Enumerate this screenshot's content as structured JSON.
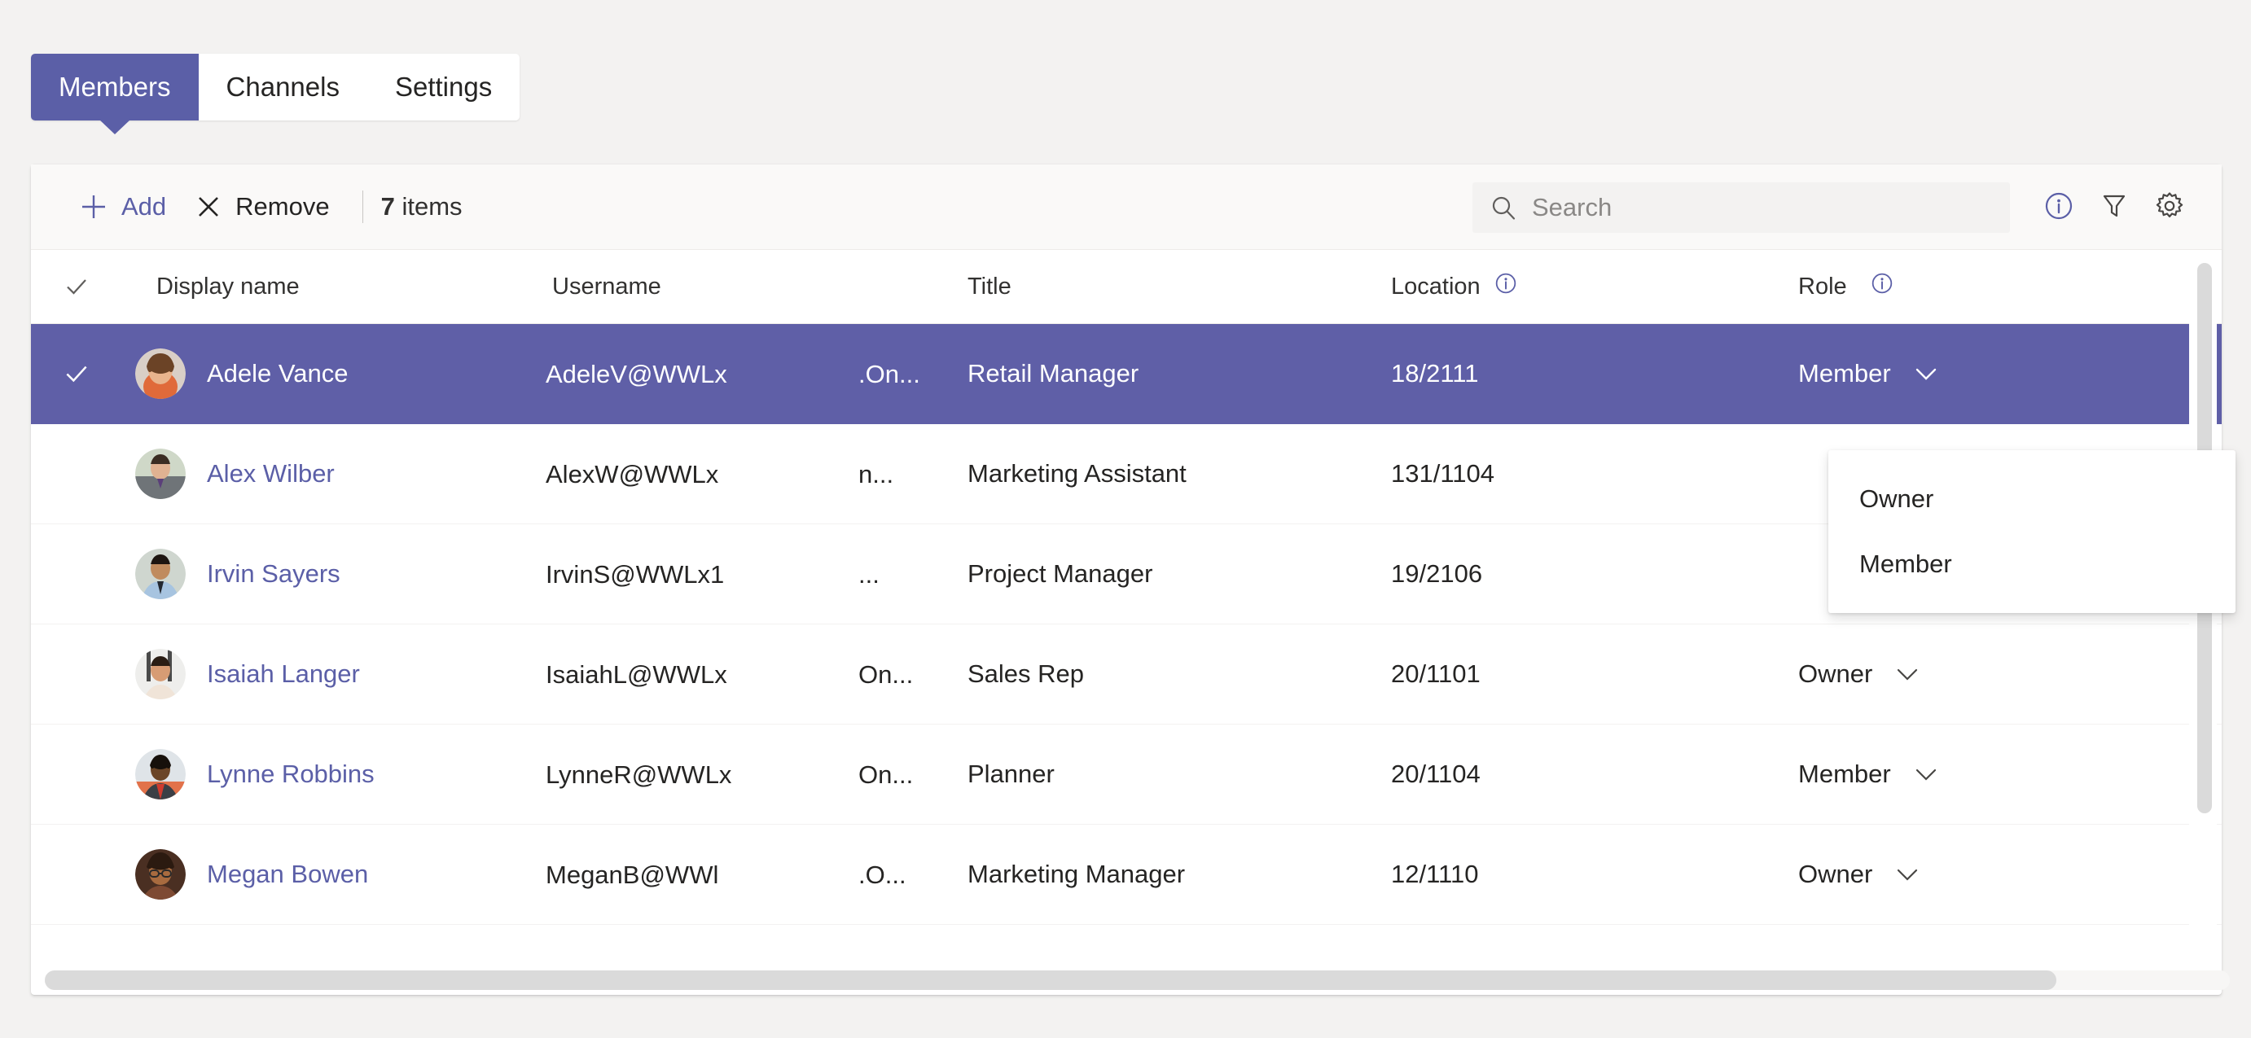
{
  "tabs": [
    {
      "label": "Members",
      "active": true
    },
    {
      "label": "Channels",
      "active": false
    },
    {
      "label": "Settings",
      "active": false
    }
  ],
  "toolbar": {
    "add_label": "Add",
    "remove_label": "Remove",
    "items_count": "7",
    "items_label": "items"
  },
  "search": {
    "placeholder": "Search",
    "value": ""
  },
  "columns": {
    "display_name": "Display name",
    "username": "Username",
    "title": "Title",
    "location": "Location",
    "role": "Role"
  },
  "rows": [
    {
      "display_name": "Adele Vance",
      "username_main": "AdeleV@WWLx",
      "username_tail": ".On...",
      "title": "Retail Manager",
      "location": "18/2111",
      "role": "Member",
      "selected": true
    },
    {
      "display_name": "Alex Wilber",
      "username_main": "AlexW@WWLx",
      "username_tail": "n...",
      "title": "Marketing Assistant",
      "location": "131/1104",
      "role": "",
      "selected": false
    },
    {
      "display_name": "Irvin Sayers",
      "username_main": "IrvinS@WWLx1",
      "username_tail": "...",
      "title": "Project Manager",
      "location": "19/2106",
      "role": "",
      "selected": false
    },
    {
      "display_name": "Isaiah Langer",
      "username_main": "IsaiahL@WWLx",
      "username_tail": "On...",
      "title": "Sales Rep",
      "location": "20/1101",
      "role": "Owner",
      "selected": false
    },
    {
      "display_name": "Lynne Robbins",
      "username_main": "LynneR@WWLx",
      "username_tail": "On...",
      "title": "Planner",
      "location": "20/1104",
      "role": "Member",
      "selected": false
    },
    {
      "display_name": "Megan Bowen",
      "username_main": "MeganB@WWl",
      "username_tail": ".O...",
      "title": "Marketing Manager",
      "location": "12/1110",
      "role": "Owner",
      "selected": false
    }
  ],
  "role_dropdown": {
    "options": [
      "Owner",
      "Member"
    ]
  },
  "icons": {
    "add": "plus-icon",
    "remove": "cross-icon",
    "search": "search-icon",
    "info": "info-icon",
    "filter": "filter-icon",
    "settings": "gear-icon",
    "check": "checkmark-icon",
    "chevron": "chevron-down-icon"
  },
  "colors": {
    "accent": "#5b5fa7",
    "row_selected": "#5f5fa7",
    "page_bg": "#f3f2f1",
    "card_bg": "#ffffff",
    "commandbar_bg": "#faf9f8"
  }
}
